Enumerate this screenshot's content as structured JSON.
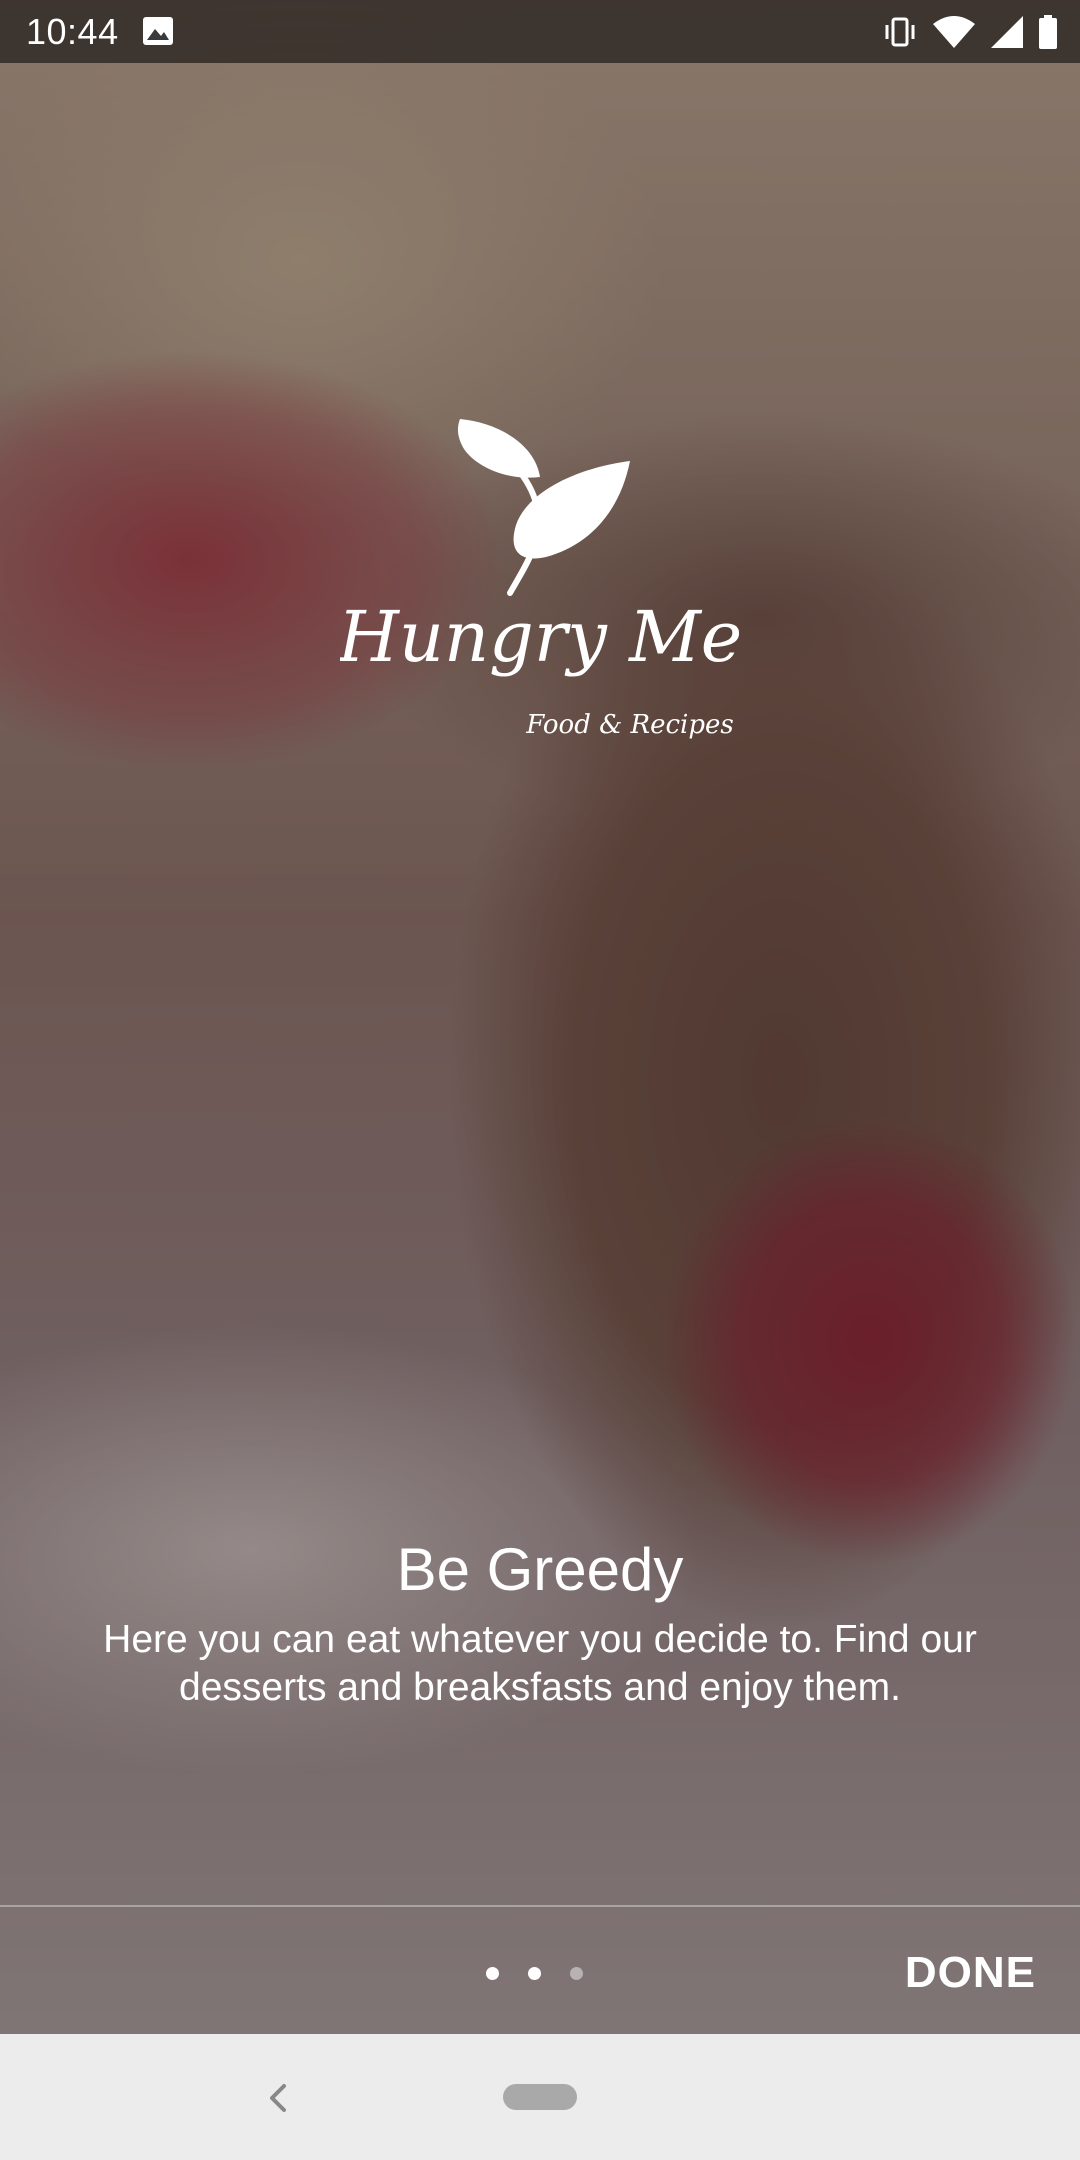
{
  "status_bar": {
    "time": "10:44",
    "icons": [
      "photo-icon",
      "vibrate-icon",
      "wifi-icon",
      "signal-icon",
      "battery-icon"
    ]
  },
  "logo": {
    "brand": "Hungry Me",
    "tagline": "Food & Recipes"
  },
  "slide": {
    "title": "Be Greedy",
    "description": "Here you can eat whatever you decide to. Find our desserts and breaksfasts and enjoy them."
  },
  "pager": {
    "total_pages": 3,
    "current_page": 2
  },
  "actions": {
    "done_label": "DONE"
  },
  "colors": {
    "text": "#ffffff",
    "nav_bar_bg": "#ececec",
    "home_pill": "#a9a9a9"
  }
}
